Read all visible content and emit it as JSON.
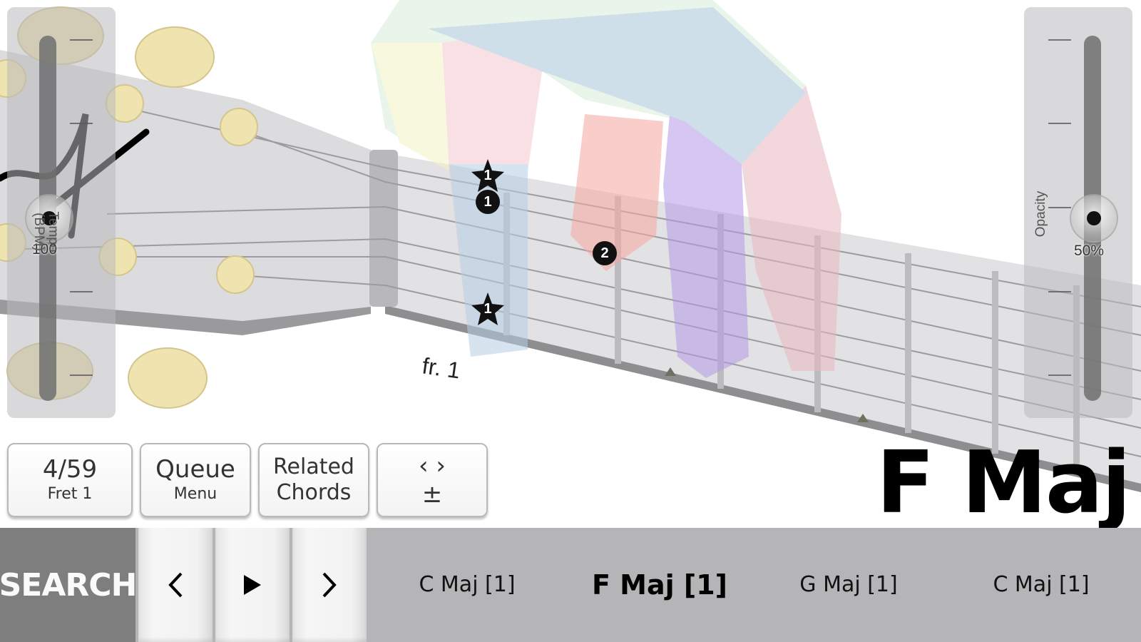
{
  "colors": {
    "background": "#ffffff",
    "bottom_bar": "#b5b4b7",
    "search_button": "#7e7e7e",
    "tuner_peg": "#efe3b0",
    "fretboard": "#dedee0",
    "marker": "#111111"
  },
  "tempo_slider": {
    "label": "Tempo\n(BPM)",
    "value": "100",
    "fraction": 0.5
  },
  "opacity_slider": {
    "label": "Opacity",
    "value": "50%",
    "fraction": 0.5
  },
  "fretboard": {
    "fret_label": "fr. 1",
    "markers": [
      {
        "finger": "1",
        "shape": "star"
      },
      {
        "finger": "1",
        "shape": "circle"
      },
      {
        "finger": "2",
        "shape": "circle"
      },
      {
        "finger": "1",
        "shape": "star"
      }
    ]
  },
  "controls": {
    "position": {
      "main": "4/59",
      "sub": "Fret 1"
    },
    "queue": {
      "main": "Queue",
      "sub": "Menu"
    },
    "related": {
      "line1": "Related",
      "line2": "Chords"
    },
    "shift": {
      "arrows": "‹  ›",
      "sub": "±"
    }
  },
  "current_chord": "F Maj",
  "bottom_bar": {
    "search_label": "SEARCH",
    "prev_icon": "‹",
    "play_icon": "▶",
    "next_icon": "›",
    "queue": [
      {
        "label": "C Maj [1]",
        "current": false
      },
      {
        "label": "F Maj [1]",
        "current": true
      },
      {
        "label": "G Maj [1]",
        "current": false
      },
      {
        "label": "C Maj [1]",
        "current": false
      }
    ]
  }
}
